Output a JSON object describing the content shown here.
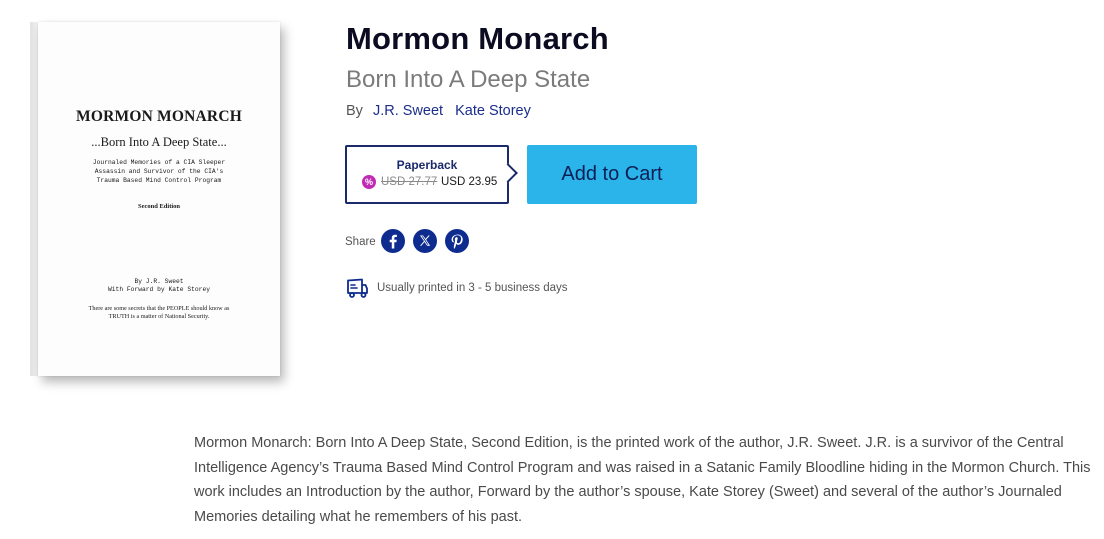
{
  "cover": {
    "title": "MORMON MONARCH",
    "subtitle": "...Born Into A Deep State...",
    "description_lines": [
      "Journaled Memories of a CIA Sleeper",
      "Assassin and Survivor of the CIA's",
      "Trauma Based Mind Control Program"
    ],
    "edition": "Second Edition",
    "author_lines": [
      "By J.R. Sweet",
      "With Forward by Kate Storey"
    ],
    "quote_lines": [
      "There are some secrets that the PEOPLE should know as",
      "TRUTH is a matter of National Security."
    ]
  },
  "book": {
    "title": "Mormon Monarch",
    "subtitle": "Born Into A Deep State",
    "by_label": "By",
    "authors": [
      "J.R. Sweet",
      "Kate Storey"
    ]
  },
  "format": {
    "label": "Paperback",
    "discount_icon": "%",
    "old_price": "USD 27.77",
    "new_price": "USD 23.95",
    "border_color": "#1b2a6b",
    "discount_color": "#c02bb5"
  },
  "cart": {
    "label": "Add to Cart",
    "color": "#2bb4ea"
  },
  "share": {
    "label": "Share",
    "networks": [
      "facebook-icon",
      "x-icon",
      "pinterest-icon"
    ],
    "icon_color": "#0e2b8f"
  },
  "shipping": {
    "icon": "truck-icon",
    "note": "Usually printed in 3 - 5 business days"
  },
  "description": "Mormon Monarch: Born Into A Deep State, Second Edition, is the printed work of the author, J.R. Sweet. J.R. is a survivor of the Central Intelligence Agency’s Trauma Based Mind Control Program and was raised in a Satanic Family Bloodline hiding in the Mormon Church. This work includes an Introduction by the author, Forward by the author’s spouse, Kate Storey (Sweet) and several of the author’s Journaled Memories detailing what he remembers of his past."
}
